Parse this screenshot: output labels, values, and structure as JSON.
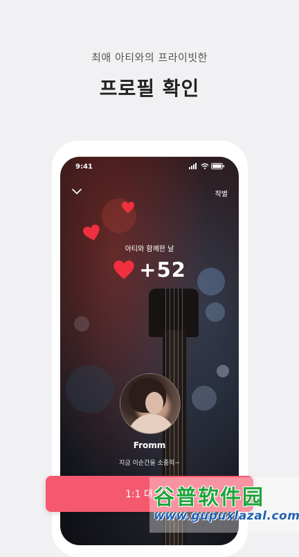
{
  "header": {
    "subtitle": "최애 아티와의 프라이빗한",
    "title": "프로필 확인"
  },
  "phone": {
    "status_time": "9:41",
    "top_bar": {
      "farewell_label": "작별"
    },
    "together": {
      "label": "아티와 함께한 날",
      "count": "+52"
    },
    "artist": {
      "name": "Fromm",
      "status": "지금 이순간을 소중히~"
    }
  },
  "cta": {
    "label": "1:1 대"
  },
  "watermark": {
    "main": "谷普软件园",
    "url": "www.gupuxlazal.com"
  },
  "colors": {
    "accent": "#f4596f",
    "heart": "#f0303f",
    "background": "#f1f1f3"
  }
}
